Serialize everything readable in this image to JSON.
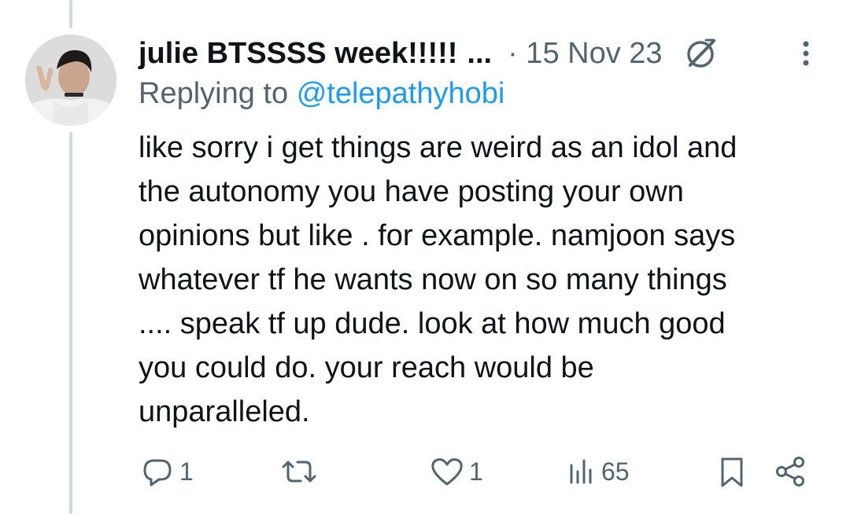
{
  "tweet": {
    "display_name": "julie BTSSSS week!!!!!",
    "truncation": "...",
    "separator_date": "· 15 Nov 23",
    "grok_icon": "grok-icon",
    "more_icon": "more-vertical-icon",
    "replying_prefix": "Replying to",
    "replying_handle": "@telepathyhobi",
    "text_lines": [
      "like sorry i get things are weird as an idol and",
      "the autonomy you have posting your own",
      "opinions but like . for example. namjoon says",
      "whatever tf he wants now on so many things",
      ".... speak tf up dude. look at how much good",
      "you could do. your reach would be",
      "unparalleled."
    ]
  },
  "actions": {
    "reply": {
      "icon": "reply-icon",
      "count": "1"
    },
    "retweet": {
      "icon": "retweet-icon",
      "count": ""
    },
    "like": {
      "icon": "heart-icon",
      "count": "1"
    },
    "views": {
      "icon": "views-icon",
      "count": "65"
    },
    "bookmark": {
      "icon": "bookmark-icon"
    },
    "share": {
      "icon": "share-icon"
    }
  },
  "colors": {
    "text": "#0f1419",
    "secondary": "#536471",
    "mention": "#1d9bf0",
    "thread_line": "#cfd9de"
  }
}
